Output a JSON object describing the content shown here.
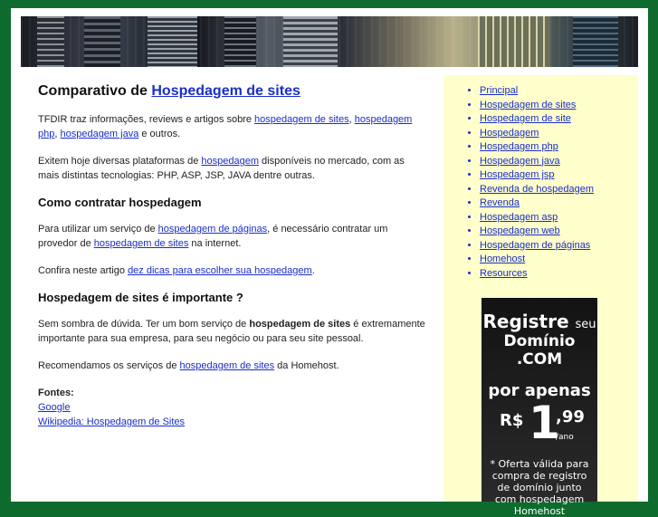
{
  "main": {
    "title_prefix": "Comparativo de ",
    "title_link": "Hospedagem de sites",
    "p1": {
      "t1": "TFDIR traz informações, reviews e artigos sobre ",
      "l1": "hospedagem de sites",
      "t2": ", ",
      "l2": "hospedagem php",
      "t3": ", ",
      "l3": "hospedagem java",
      "t4": " e outros."
    },
    "p2": {
      "t1": "Exitem hoje diversas plataformas de ",
      "l1": "hospedagem",
      "t2": " disponíveis no mercado, com as mais distintas tecnologias: PHP, ASP, JSP, JAVA dentre outras."
    },
    "h2_1": "Como contratar hospedagem",
    "p3": {
      "t1": "Para utilizar um serviço de ",
      "l1": "hospedagem de páginas",
      "t2": ", é necessário contratar um provedor de ",
      "l2": "hospedagem de sites",
      "t3": " na internet."
    },
    "p4": {
      "t1": "Confira neste artigo ",
      "l1": "dez dicas para escolher sua hospedagem",
      "t2": "."
    },
    "h2_2": "Hospedagem de sites é importante ?",
    "p5": {
      "t1": "Sem sombra de dúvida. Ter um bom serviço de ",
      "b1": "hospedagem de sites",
      "t2": " é extremamente importante para sua empresa, para seu negócio ou para seu site pessoal."
    },
    "p6": {
      "t1": "Recomendamos os serviços de ",
      "l1": "hospedagem de sites",
      "t2": " da Homehost."
    },
    "fontes_label": "Fontes:",
    "fontes": [
      "Google",
      "Wikipedia: Hospedagem de Sites"
    ]
  },
  "sidebar": {
    "links": [
      "Principal",
      "Hospedagem de sites",
      "Hospedagem de site",
      "Hospedagem",
      "Hospedagem php",
      "Hospedagem java",
      "Hospedagem jsp",
      "Revenda de hospedagem",
      "Revenda",
      "Hospedagem asp",
      "Hospedagem web",
      "Hospedagem de páginas",
      "Homehost",
      "Resources"
    ]
  },
  "ad": {
    "registre": "Registre",
    "seu": "seu",
    "dominio": "Domínio .COM",
    "por_apenas": "por apenas",
    "currency": "R$",
    "whole": "1",
    "cents": ",99",
    "per": "/ano",
    "note": "* Oferta válida para compra de registro de domínio junto com hospedagem Homehost"
  },
  "colors": {
    "page_bg": "#0e6b2e",
    "sidebar_bg": "#ffffcc",
    "link": "#1a2ec8"
  }
}
